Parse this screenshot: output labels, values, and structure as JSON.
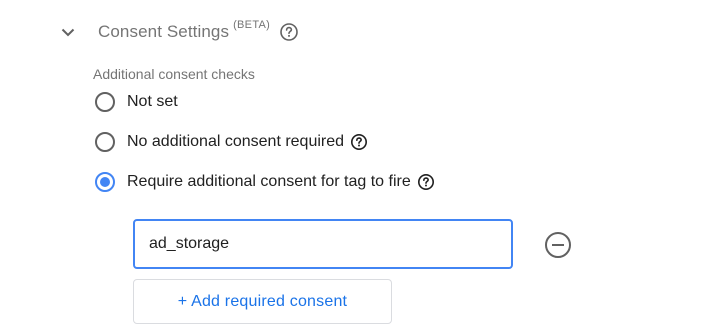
{
  "section": {
    "title": "Consent Settings",
    "badge": "(BETA)",
    "icons": {
      "toggle": "chevron-down-icon",
      "help": "help-circle-icon"
    }
  },
  "consent": {
    "group_label": "Additional consent checks",
    "options": [
      {
        "label": "Not set",
        "selected": false,
        "has_help": false
      },
      {
        "label": "No additional consent required",
        "selected": false,
        "has_help": true
      },
      {
        "label": "Require additional consent for tag to fire",
        "selected": true,
        "has_help": true
      }
    ],
    "required_consents": [
      {
        "value": "ad_storage",
        "remove_icon": "remove-circle-icon"
      }
    ],
    "add_button_label": "+ Add required consent"
  },
  "colors": {
    "accent": "#4285f4",
    "link": "#1a73e8",
    "muted_text": "#757575",
    "body_text": "#212121"
  }
}
